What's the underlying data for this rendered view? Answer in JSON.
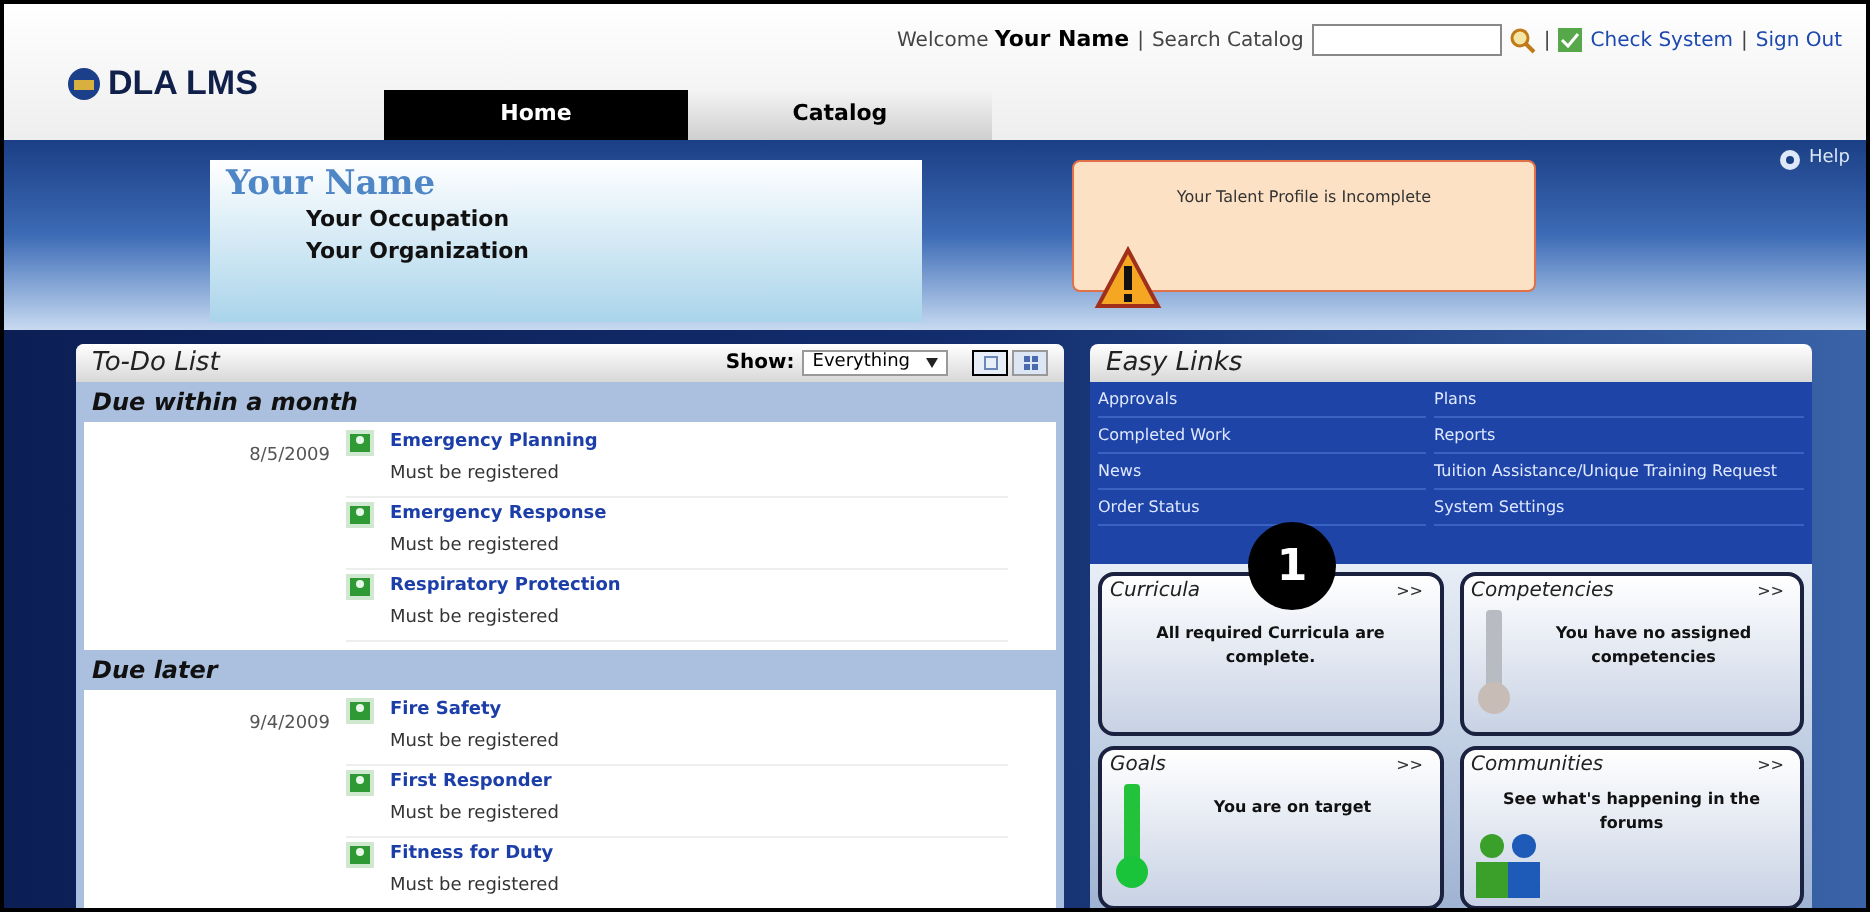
{
  "header": {
    "logo": "DLA LMS",
    "welcome": "Welcome",
    "user_name": "Your Name",
    "separators": [
      "|",
      "|",
      "|"
    ],
    "search_label": "Search Catalog",
    "check_system": "Check System",
    "sign_out": "Sign Out"
  },
  "tabs": [
    {
      "label": "Home",
      "selected": true
    },
    {
      "label": "Catalog",
      "selected": false
    }
  ],
  "profile": {
    "name": "Your Name",
    "occupation": "Your Occupation",
    "organization": "Your Organization"
  },
  "alert": {
    "text": "Your Talent Profile is Incomplete"
  },
  "help": "Help",
  "todo": {
    "title": "To-Do List",
    "show_label": "Show:",
    "show_value": "Everything",
    "view_buttons": [
      {
        "kind": "list",
        "selected": true
      },
      {
        "kind": "grid",
        "selected": false
      }
    ],
    "sections": [
      {
        "heading": "Due within a month",
        "groups": [
          {
            "date": "8/5/2009",
            "items": [
              {
                "title": "Emergency Planning",
                "status": "Must be registered"
              },
              {
                "title": "Emergency Response",
                "status": "Must be registered"
              },
              {
                "title": "Respiratory Protection",
                "status": "Must be registered"
              }
            ]
          }
        ]
      },
      {
        "heading": "Due later",
        "groups": [
          {
            "date": "9/4/2009",
            "items": [
              {
                "title": "Fire Safety",
                "status": "Must be registered"
              },
              {
                "title": "First Responder",
                "status": "Must be registered"
              },
              {
                "title": "Fitness for Duty",
                "status": "Must be registered"
              }
            ]
          }
        ]
      }
    ]
  },
  "easy_links": {
    "title": "Easy Links",
    "columns": [
      [
        "Approvals",
        "Completed Work",
        "News",
        "Order Status"
      ],
      [
        "Plans",
        "Reports",
        "Tuition Assistance/Unique Training Request",
        "System Settings"
      ]
    ]
  },
  "widgets": [
    {
      "title": "Curricula",
      "more": ">>",
      "text": "All required Curricula are complete.",
      "kind": "none"
    },
    {
      "title": "Competencies",
      "more": ">>",
      "text": "You have no assigned competencies",
      "kind": "thermometer-empty"
    },
    {
      "title": "Goals",
      "more": ">>",
      "text": "You are on target",
      "kind": "thermometer-full"
    },
    {
      "title": "Communities",
      "more": ">>",
      "text": "See what's happening in the forums",
      "kind": "people"
    }
  ],
  "callout": "1"
}
